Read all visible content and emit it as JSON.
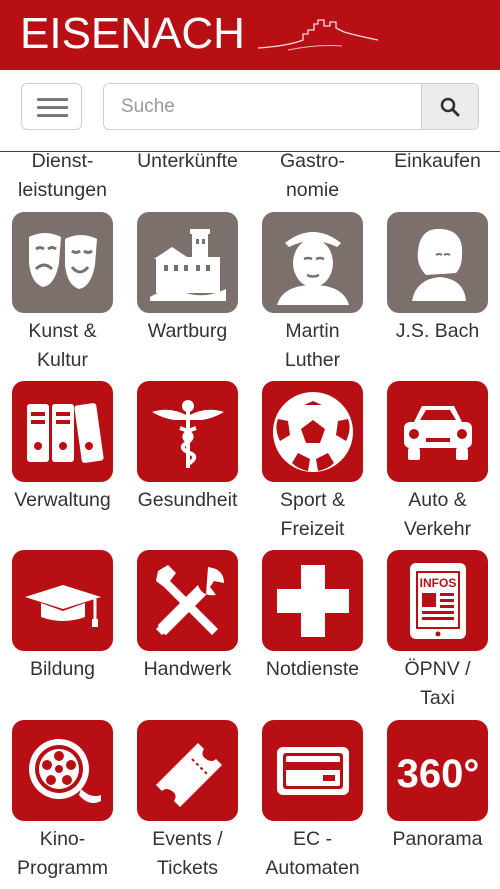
{
  "header": {
    "title": "EISENACH",
    "logo": "wartburg-castle-outline-logo"
  },
  "search": {
    "placeholder": "Suche",
    "menu_icon": "hamburger-icon",
    "search_icon": "magnifier-icon"
  },
  "partial_row": [
    "Dienst-\nleistungen",
    "Unterkünfte",
    "Gastro-\nnomie",
    "Einkaufen"
  ],
  "tiles": [
    {
      "label": "Kunst &\nKultur",
      "icon": "theater-masks-icon",
      "color": "#7b706c"
    },
    {
      "label": "Wartburg",
      "icon": "castle-icon",
      "color": "#7b706c"
    },
    {
      "label": "Martin\nLuther",
      "icon": "luther-portrait-icon",
      "color": "#7b706c"
    },
    {
      "label": "J.S. Bach",
      "icon": "bach-portrait-icon",
      "color": "#7b706c"
    },
    {
      "label": "Verwaltung",
      "icon": "binders-icon",
      "color": "#b80f14"
    },
    {
      "label": "Gesundheit",
      "icon": "caduceus-icon",
      "color": "#b80f14"
    },
    {
      "label": "Sport &\nFreizeit",
      "icon": "soccer-ball-icon",
      "color": "#b80f14"
    },
    {
      "label": "Auto &\nVerkehr",
      "icon": "car-icon",
      "color": "#b80f14"
    },
    {
      "label": "Bildung",
      "icon": "graduation-cap-icon",
      "color": "#b80f14"
    },
    {
      "label": "Handwerk",
      "icon": "tools-icon",
      "color": "#b80f14"
    },
    {
      "label": "Notdienste",
      "icon": "emergency-cross-icon",
      "color": "#b80f14"
    },
    {
      "label": "ÖPNV /\nTaxi",
      "icon": "transit-info-icon",
      "color": "#b80f14"
    },
    {
      "label": "Kino-\nProgramm",
      "icon": "film-reel-icon",
      "color": "#b80f14"
    },
    {
      "label": "Events /\nTickets",
      "icon": "ticket-icon",
      "color": "#b80f14"
    },
    {
      "label": "EC -\nAutomaten",
      "icon": "credit-card-icon",
      "color": "#b80f14"
    },
    {
      "label": "Panorama",
      "icon": "panorama-360-icon",
      "color": "#b80f14"
    }
  ],
  "panorama_text": "360°",
  "colors": {
    "brand_red": "#b80f14",
    "tile_gray": "#7b706c"
  }
}
